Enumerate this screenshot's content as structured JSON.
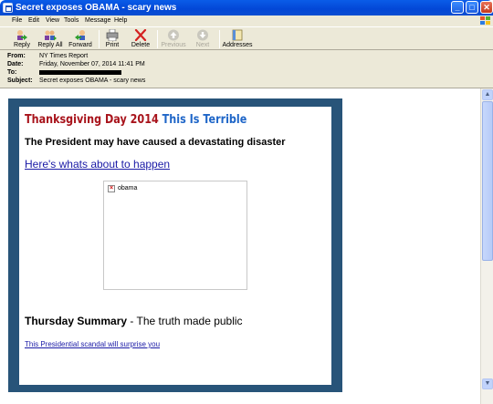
{
  "window": {
    "title": "Secret exposes OBAMA - scary news",
    "minimize_glyph": "_",
    "maximize_glyph": "□",
    "close_glyph": "✕"
  },
  "menu": [
    "File",
    "Edit",
    "View",
    "Tools",
    "Message",
    "Help"
  ],
  "toolbar": {
    "reply": "Reply",
    "reply_all": "Reply All",
    "forward": "Forward",
    "print": "Print",
    "delete": "Delete",
    "previous": "Previous",
    "next": "Next",
    "addresses": "Addresses"
  },
  "header": {
    "from_label": "From:",
    "from_value": "NY Times Report",
    "date_label": "Date:",
    "date_value": "Friday, November 07, 2014 11:41 PM",
    "to_label": "To:",
    "subject_label": "Subject:",
    "subject_value": "Secret exposes OBAMA - scary news"
  },
  "email": {
    "headline_red": "Thanksgiving Day 2014",
    "headline_blue": "This Is Terrible",
    "subhead": "The President may have caused a devastating disaster",
    "link_main": "Here's whats about to happen",
    "image_alt": "obama",
    "summary_bold": "Thursday Summary",
    "summary_rest": " - The truth made public",
    "link_small": "This Presidential scandal will surprise you"
  },
  "colors": {
    "frame": "#285479",
    "headline_red": "#a8131b",
    "headline_blue": "#1f66c8",
    "link": "#1a1aa6"
  }
}
